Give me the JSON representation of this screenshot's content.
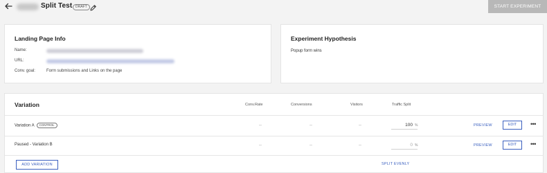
{
  "header": {
    "title": "Split Test",
    "status_badge": "DRAFT",
    "start_button": "START EXPERIMENT"
  },
  "landing_page_info": {
    "title": "Landing Page Info",
    "rows": [
      {
        "label": "Name:",
        "value": ""
      },
      {
        "label": "URL:",
        "value": ""
      },
      {
        "label": "Conv. goal:",
        "value": "Form submissions and Links on the page"
      }
    ]
  },
  "hypothesis": {
    "title": "Experiment Hypothesis",
    "text": "Popup form wins"
  },
  "variations": {
    "title": "Variation",
    "columns": [
      "Conv.Rate",
      "Conversions",
      "Visitors",
      "Traffic Split"
    ],
    "rows": [
      {
        "name": "Variation A",
        "badge": "CONTROL",
        "conv_rate": "--",
        "conversions": "--",
        "visitors": "--",
        "traffic_split": "100",
        "percent": "%",
        "preview": "PREVIEW",
        "edit": "EDIT"
      },
      {
        "name": "Paused - Variation B",
        "badge": "",
        "conv_rate": "--",
        "conversions": "--",
        "visitors": "--",
        "traffic_split": "0",
        "percent": "%",
        "preview": "PREVIEW",
        "edit": "EDIT"
      }
    ],
    "add_button": "ADD VARIATION",
    "split_evenly": "SPLIT EVENLY"
  },
  "colors": {
    "accent": "#3a5fbf",
    "start_button_bg": "#b8b8b8",
    "page_bg": "#f3f3f3"
  },
  "icons": [
    "back-arrow-icon",
    "pencil-icon",
    "more-options-icon"
  ]
}
